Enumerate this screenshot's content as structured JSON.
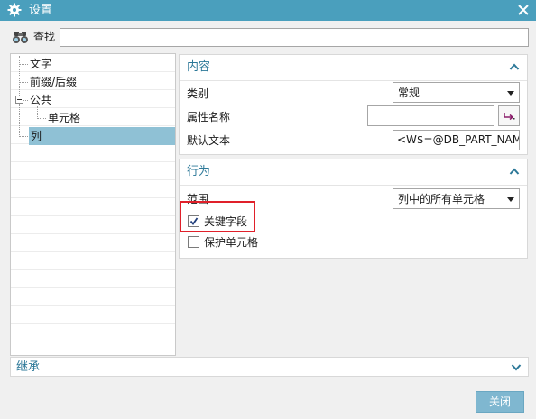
{
  "window": {
    "title": "设置"
  },
  "search": {
    "label": "查找",
    "value": "",
    "placeholder": ""
  },
  "tree": {
    "items": [
      {
        "label": "文字",
        "selected": false
      },
      {
        "label": "前缀/后缀",
        "selected": false
      },
      {
        "label": "公共",
        "selected": false,
        "expanded": true
      },
      {
        "label": "单元格",
        "selected": false
      },
      {
        "label": "列",
        "selected": true
      }
    ]
  },
  "content_section": {
    "title": "内容",
    "category_label": "类别",
    "category_value": "常规",
    "attribute_name_label": "属性名称",
    "attribute_name_value": "",
    "default_text_label": "默认文本",
    "default_text_value": "<W$=@DB_PART_NAM"
  },
  "behavior_section": {
    "title": "行为",
    "scope_label": "范围",
    "scope_value": "列中的所有单元格",
    "key_field_label": "关键字段",
    "key_field_checked": true,
    "protect_cells_label": "保护单元格",
    "protect_cells_checked": false
  },
  "inherit_section": {
    "title": "继承"
  },
  "buttons": {
    "close_label": "关闭"
  },
  "colors": {
    "titlebar": "#4a9fbd",
    "section_title": "#2c7898",
    "selection": "#8fc1d5",
    "highlight": "#e0202a",
    "close_button": "#7fb7d0"
  }
}
